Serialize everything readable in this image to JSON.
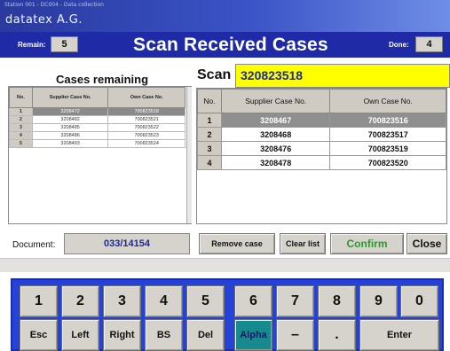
{
  "titlebar": {
    "system_text": "Station 001 - DC004 - Data collection",
    "company": "datatex A.G."
  },
  "header": {
    "remain_label": "Remain:",
    "remain_value": "5",
    "title": "Scan Received Cases",
    "done_label": "Done:",
    "done_value": "4"
  },
  "remaining": {
    "title": "Cases remaining",
    "columns": [
      "No.",
      "Supplier Case No.",
      "Own Case No."
    ],
    "rows": [
      {
        "no": "1",
        "supplier": "3208472",
        "own": "700823518"
      },
      {
        "no": "2",
        "supplier": "3208482",
        "own": "700823521"
      },
      {
        "no": "3",
        "supplier": "3208485",
        "own": "700823522"
      },
      {
        "no": "4",
        "supplier": "3208486",
        "own": "700823523"
      },
      {
        "no": "5",
        "supplier": "3208493",
        "own": "700823524"
      }
    ]
  },
  "scan": {
    "label": "Scan",
    "value": "320823518"
  },
  "received": {
    "columns": [
      "No.",
      "Supplier Case No.",
      "Own Case No."
    ],
    "rows": [
      {
        "no": "1",
        "supplier": "3208467",
        "own": "700823516"
      },
      {
        "no": "2",
        "supplier": "3208468",
        "own": "700823517"
      },
      {
        "no": "3",
        "supplier": "3208476",
        "own": "700823519"
      },
      {
        "no": "4",
        "supplier": "3208478",
        "own": "700823520"
      }
    ]
  },
  "document": {
    "label": "Document:",
    "value": "033/14154"
  },
  "actions": {
    "remove_case": "Remove case",
    "clear_list": "Clear list",
    "confirm": "Confirm",
    "close": "Close"
  },
  "colors": {
    "header_blue": "#1e2aa6",
    "scan_yellow": "#ffff00",
    "confirm_green": "#2a9a2a",
    "keypad_blue": "#2643d9",
    "alpha_teal": "#158a8f"
  },
  "keypad": {
    "row1": [
      "1",
      "2",
      "3",
      "4",
      "5",
      "6",
      "7",
      "8",
      "9",
      "0"
    ],
    "row2": [
      "Esc",
      "Left",
      "Right",
      "BS",
      "Del",
      "Alpha",
      "–",
      ".",
      "Enter"
    ]
  }
}
